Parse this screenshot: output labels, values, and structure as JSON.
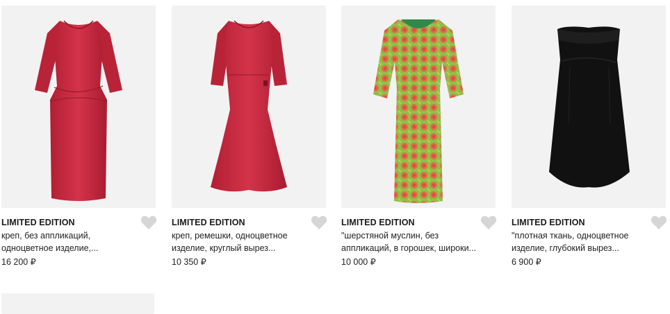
{
  "products": [
    {
      "brand": "LIMITED EDITION",
      "desc_line1": "креп, без аппликаций,",
      "desc_line2": "одноцветное изделие,...",
      "price": "16 200 ₽",
      "dress_color": "#c8283c"
    },
    {
      "brand": "LIMITED EDITION",
      "desc_line1": "креп, ремешки, одноцветное",
      "desc_line2": "изделие, круглый вырез...",
      "price": "10 350 ₽",
      "dress_color": "#c8283c"
    },
    {
      "brand": "LIMITED EDITION",
      "desc_line1": "\"шерстяной муслин, без",
      "desc_line2": "аппликаций, в горошек, широки...",
      "price": "10 000 ₽",
      "dress_color": "#8bbf4a"
    },
    {
      "brand": "LIMITED EDITION",
      "desc_line1": "\"плотная ткань, одноцветное",
      "desc_line2": "изделие, глубокий вырез...",
      "price": "6 900 ₽",
      "dress_color": "#111111"
    }
  ],
  "icons": {
    "wishlist": "heart-icon"
  },
  "colors": {
    "tile_background": "#f2f2f2",
    "heart": "#d6d6d6"
  }
}
